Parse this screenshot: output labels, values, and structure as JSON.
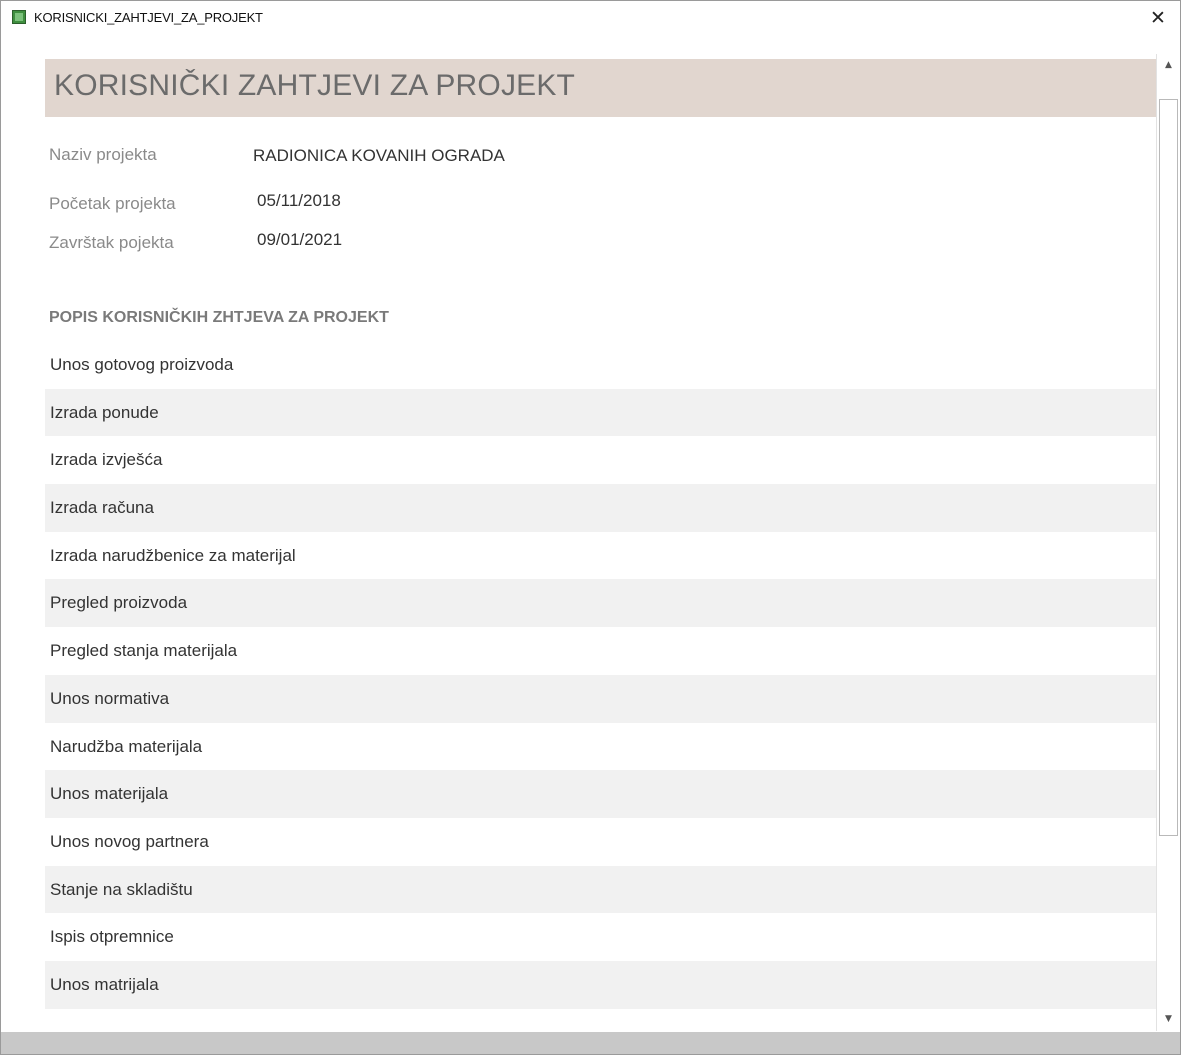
{
  "window": {
    "title": "KORISNICKI_ZAHTJEVI_ZA_PROJEKT",
    "close_label": "✕",
    "icon": "access-form-icon"
  },
  "form": {
    "title": "KORISNIČKI ZAHTJEVI ZA PROJEKT",
    "fields": {
      "naziv_label": "Naziv projekta",
      "naziv_value": "RADIONICA KOVANIH OGRADA",
      "pocetak_label": "Početak projekta",
      "pocetak_value": "05/11/2018",
      "zavrsetak_label": "Završtak pojekta",
      "zavrsetak_value": "09/01/2021"
    },
    "list_heading": "POPIS KORISNIČKIH ZHTJEVA ZA PROJEKT",
    "requirements": [
      "Unos gotovog proizvoda",
      "Izrada ponude",
      "Izrada izvješća",
      "Izrada računa",
      "Izrada narudžbenice za materijal",
      "Pregled proizvoda",
      "Pregled stanja materijala",
      "Unos normativa",
      "Narudžba materijala",
      "Unos materijala",
      "Unos novog partnera",
      "Stanje na skladištu",
      "Ispis otpremnice",
      "Unos matrijala"
    ]
  },
  "scrollbar": {
    "up_arrow": "▲",
    "down_arrow": "▼"
  },
  "colors": {
    "header_band": "#e1d6cf",
    "title_text": "#6b6b6b",
    "alt_row": "#f1f1f1",
    "status_bar": "#c8c8c8"
  }
}
